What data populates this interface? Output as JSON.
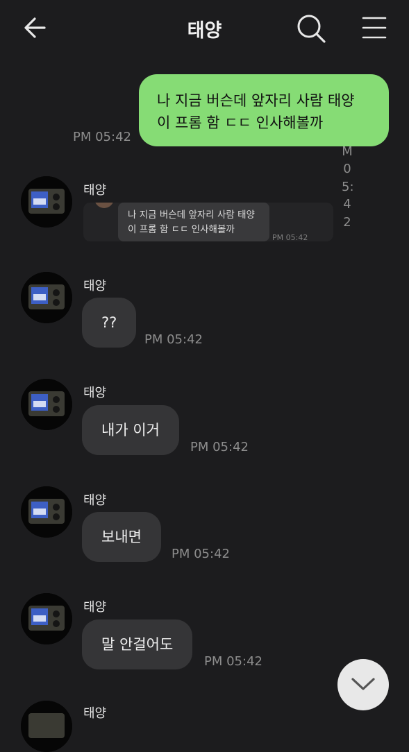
{
  "header": {
    "title": "태양",
    "back_icon": "arrow-left-icon",
    "search_icon": "search-icon",
    "menu_icon": "hamburger-menu-icon"
  },
  "outgoing": {
    "line1": "나 지금 버슨데 앞자리 사람 태양",
    "line2": "이 프롬 함 ㄷㄷ 인사해볼까",
    "time": "PM 05:42",
    "vertical_time": [
      "M",
      "0",
      "5:",
      "4",
      "2"
    ]
  },
  "reply_preview": {
    "line1": "나 지금 버슨데 앞자리 사람 태양",
    "line2": "이 프롬 함 ㄷㄷ 인사해볼까",
    "time": "PM 05:42"
  },
  "messages": [
    {
      "sender": "태양",
      "text": "",
      "time": ""
    },
    {
      "sender": "태양",
      "text": "??",
      "time": "PM 05:42"
    },
    {
      "sender": "태양",
      "text": "내가 이거",
      "time": "PM 05:42"
    },
    {
      "sender": "태양",
      "text": "보내면",
      "time": "PM 05:42"
    },
    {
      "sender": "태양",
      "text": "말 안걸어도",
      "time": "PM 05:42"
    },
    {
      "sender": "태양",
      "text": "",
      "time": ""
    }
  ],
  "scroll_button_icon": "chevron-down-icon",
  "colors": {
    "background": "#1c1c1e",
    "outgoing_bubble": "#86dc75",
    "incoming_bubble": "#353537",
    "timestamp": "#8d8d8d"
  }
}
